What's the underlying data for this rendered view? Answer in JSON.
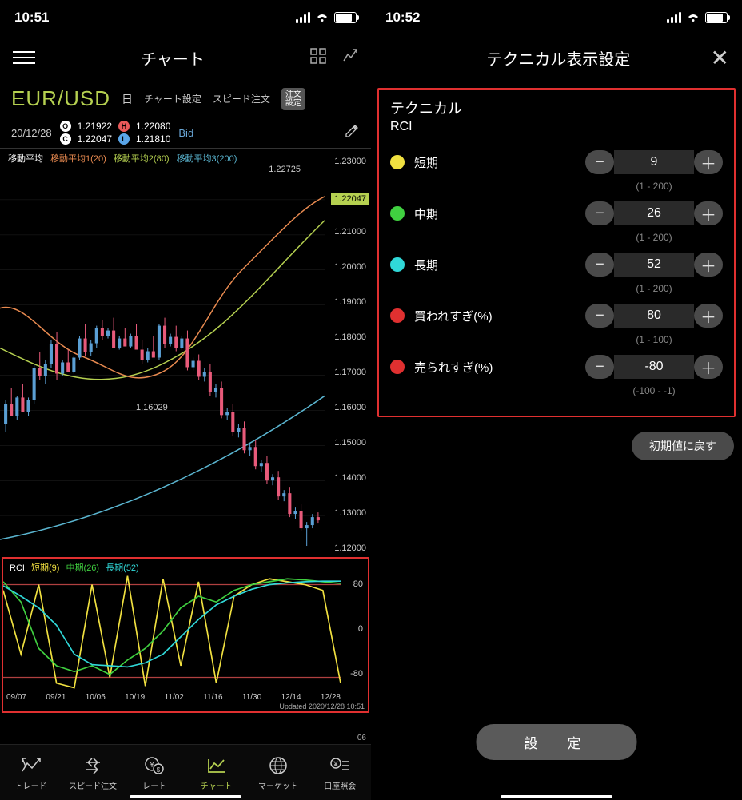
{
  "left": {
    "status_time": "10:51",
    "header_title": "チャート",
    "symbol": "EUR/USD",
    "period": "日",
    "chart_setting": "チャート設定",
    "speed_order": "スピード注文",
    "order_setting": "注文\n設定",
    "date": "20/12/28",
    "ohlc": {
      "o": "1.21922",
      "h": "1.22080",
      "c": "1.22047",
      "l": "1.21810"
    },
    "bid": "Bid",
    "ma_legend": {
      "label": "移動平均",
      "ma1": "移動平均1(20)",
      "ma2": "移動平均2(80)",
      "ma3": "移動平均3(200)"
    },
    "price_hi": "1.22725",
    "price_lo": "1.16029",
    "price_current": "1.22047",
    "rci_legend": {
      "label": "RCI",
      "s": "短期(9)",
      "m": "中期(26)",
      "l": "長期(52)"
    },
    "rci_updated": "Updated  2020/12/28 10:51",
    "x_ticks_extra": "06",
    "nav": {
      "trade": "トレード",
      "speed": "スピード注文",
      "rate": "レート",
      "chart": "チャート",
      "market": "マーケット",
      "account": "口座照会"
    }
  },
  "right": {
    "status_time": "10:52",
    "header_title": "テクニカル表示設定",
    "panel_title": "テクニカル",
    "panel_subtitle": "RCI",
    "rows": [
      {
        "color": "#f0e040",
        "label": "短期",
        "value": "9",
        "range": "(1 - 200)"
      },
      {
        "color": "#40d040",
        "label": "中期",
        "value": "26",
        "range": "(1 - 200)"
      },
      {
        "color": "#30d8d8",
        "label": "長期",
        "value": "52",
        "range": "(1 - 200)"
      },
      {
        "color": "#e03030",
        "label": "買われすぎ(%)",
        "value": "80",
        "range": "(1 - 100)"
      },
      {
        "color": "#e03030",
        "label": "売られすぎ(%)",
        "value": "-80",
        "range": "(-100 - -1)"
      }
    ],
    "reset": "初期値に戻す",
    "apply": "設　定"
  },
  "chart_data": {
    "main": {
      "type": "candlestick",
      "y_ticks": [
        1.23,
        1.22,
        1.21,
        1.2,
        1.19,
        1.18,
        1.17,
        1.16,
        1.15,
        1.14,
        1.13,
        1.12
      ],
      "y_tick_labels": [
        "1.23000",
        "1.22000",
        "1.21000",
        "1.20000",
        "1.19000",
        "1.18000",
        "1.17000",
        "1.16000",
        "1.15000",
        "1.14000",
        "1.13000",
        "1.12000"
      ],
      "high_annotation": 1.22725,
      "low_annotation": 1.16029,
      "current": 1.22047,
      "series_overlays": [
        {
          "name": "移動平均1(20)",
          "color": "#e88a50"
        },
        {
          "name": "移動平均2(80)",
          "color": "#b5d050"
        },
        {
          "name": "移動平均3(200)",
          "color": "#5ab5d0"
        }
      ]
    },
    "rci": {
      "type": "line",
      "y_ticks": [
        80,
        0,
        -80
      ],
      "x_ticks": [
        "09/07",
        "09/21",
        "10/05",
        "10/19",
        "11/02",
        "11/16",
        "11/30",
        "12/14",
        "12/28"
      ],
      "overbought": 80,
      "oversold": -80,
      "series": [
        {
          "name": "短期(9)",
          "color": "#f0e040",
          "values": [
            70,
            -40,
            80,
            -90,
            -98,
            80,
            -80,
            95,
            -95,
            90,
            -60,
            85,
            -90,
            60,
            80,
            90,
            85,
            80,
            70,
            -90
          ]
        },
        {
          "name": "中期(26)",
          "color": "#40d040",
          "values": [
            85,
            50,
            -30,
            -60,
            -70,
            -60,
            -75,
            -50,
            -30,
            0,
            40,
            60,
            50,
            70,
            80,
            85,
            90,
            88,
            85,
            82
          ]
        },
        {
          "name": "長期(52)",
          "color": "#30d8d8",
          "values": [
            78,
            60,
            40,
            10,
            -40,
            -58,
            -60,
            -62,
            -55,
            -40,
            -10,
            20,
            45,
            60,
            72,
            80,
            83,
            85,
            86,
            86
          ]
        }
      ]
    }
  }
}
